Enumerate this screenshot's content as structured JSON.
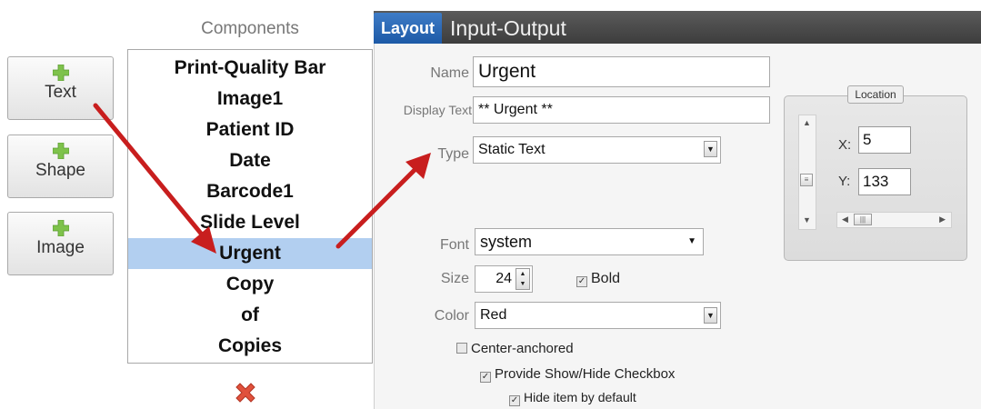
{
  "add_buttons": [
    {
      "label": "Text",
      "icon": "plus-icon"
    },
    {
      "label": "Shape",
      "icon": "plus-icon"
    },
    {
      "label": "Image",
      "icon": "plus-icon"
    }
  ],
  "components": {
    "title": "Components",
    "items": [
      "Print-Quality Bar",
      "Image1",
      "Patient ID",
      "Date",
      "Barcode1",
      "Slide Level",
      "Urgent",
      "Copy",
      "of",
      "Copies"
    ],
    "selected": "Urgent",
    "delete_icon": "x-delete-icon"
  },
  "tabs": {
    "layout": "Layout",
    "io": "Input-Output"
  },
  "form": {
    "name_label": "Name",
    "name_value": "Urgent",
    "display_label": "Display Text",
    "display_value": "** Urgent **",
    "type_label": "Type",
    "type_value": "Static Text",
    "font_label": "Font",
    "font_value": "system",
    "size_label": "Size",
    "size_value": "24",
    "bold_label": "Bold",
    "bold_checked": true,
    "color_label": "Color",
    "color_value": "Red",
    "center_label": "Center-anchored",
    "center_checked": false,
    "showhide_label": "Provide Show/Hide Checkbox",
    "showhide_checked": true,
    "hide_label": "Hide item by default",
    "hide_checked": true
  },
  "location": {
    "title": "Location",
    "x_label": "X:",
    "x_value": "5",
    "y_label": "Y:",
    "y_value": "133"
  },
  "colors": {
    "accent_tab": "#2a67b3",
    "selection": "#b2cff0",
    "arrow": "#c81e1e"
  }
}
